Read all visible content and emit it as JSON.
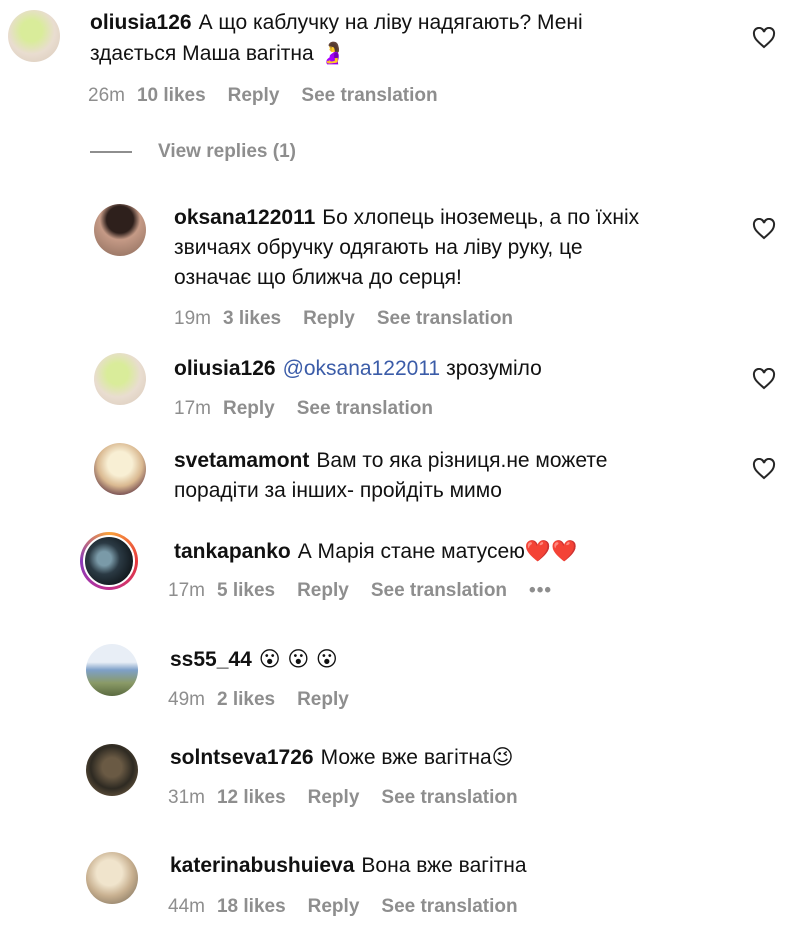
{
  "comments": [
    {
      "user": "oliusia126",
      "text": "А що каблучку на ліву надягають? Мені",
      "text2": "здається Маша вагітна",
      "emoji": "🤰",
      "time": "26m",
      "likes": "10 likes",
      "reply": "Reply",
      "translate": "See translation",
      "avatar_colors": [
        "#c9e07c",
        "#e8d8c8"
      ]
    },
    {
      "user": "oksana122011",
      "text": "Бо хлопець іноземець, а по їхніх",
      "text2": "звичаях обручку одягають на ліву руку, це",
      "text3": "означає що ближча до серця!",
      "time": "19m",
      "likes": "3 likes",
      "reply": "Reply",
      "translate": "See translation",
      "avatar_colors": [
        "#3a2a26",
        "#c9a18e"
      ]
    },
    {
      "user": "oliusia126",
      "mention": "@oksana122011",
      "text": "зрозуміло",
      "time": "17m",
      "reply": "Reply",
      "translate": "See translation",
      "avatar_colors": [
        "#c9e07c",
        "#e8d8c8"
      ]
    },
    {
      "user": "svetamamont",
      "text": "Вам то яка різниця.не можете",
      "text2": "порадіти за інших- пройдіть мимо",
      "avatar_colors": [
        "#f2e6c8",
        "#b08a7a"
      ]
    },
    {
      "user": "tankapanko",
      "text": "А Марія стане матусею",
      "emoji": "❤️❤️",
      "time": "17m",
      "likes": "5 likes",
      "reply": "Reply",
      "translate": "See translation",
      "more": "•••"
    },
    {
      "user": "ss55_44",
      "text": "",
      "emoji": "😮 😮 😮",
      "time": "49m",
      "likes": "2 likes",
      "reply": "Reply",
      "avatar_colors": [
        "#7ea0c8",
        "#8a9a66"
      ]
    },
    {
      "user": "solntseva1726",
      "text": "Може вже вагітна",
      "emoji": "😉",
      "time": "31m",
      "likes": "12 likes",
      "reply": "Reply",
      "translate": "See translation",
      "avatar_colors": [
        "#5a4a36",
        "#a89070"
      ]
    },
    {
      "user": "katerinabushuieva",
      "text": "Вона вже вагітна",
      "time": "44m",
      "likes": "18 likes",
      "reply": "Reply",
      "translate": "See translation",
      "avatar_colors": [
        "#e8dcc6",
        "#9a8a70"
      ]
    }
  ],
  "view_replies": "View replies (1)"
}
